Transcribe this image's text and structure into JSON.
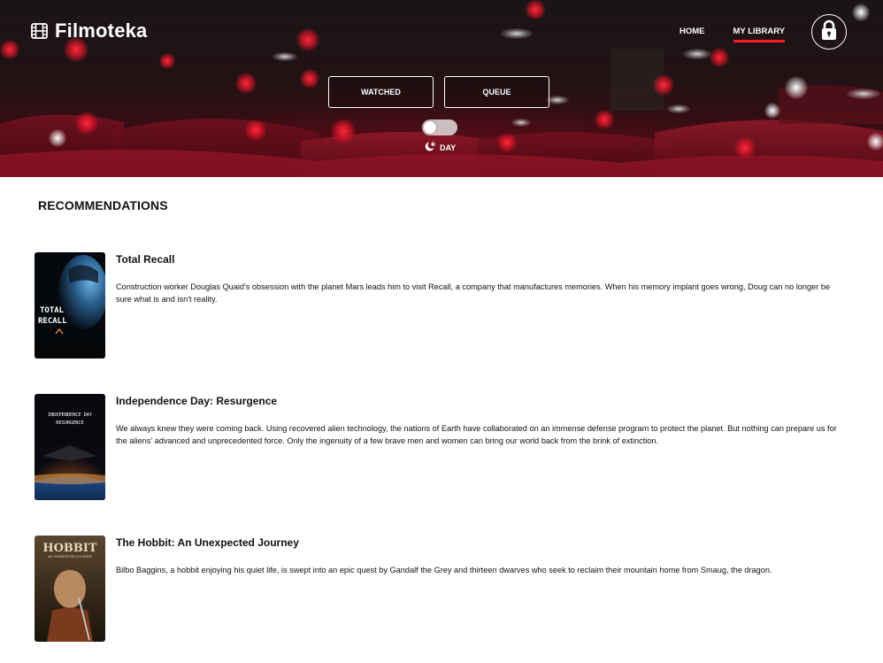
{
  "header": {
    "logo_text": "Filmoteka",
    "nav": {
      "home": "HOME",
      "library": "MY LIBRARY"
    },
    "library_buttons": {
      "watched": "WATCHED",
      "queue": "QUEUE"
    },
    "theme": {
      "label": "DAY",
      "mode": "day"
    }
  },
  "main": {
    "section_title": "RECOMMENDATIONS",
    "movies": [
      {
        "title": "Total Recall",
        "description": "Construction worker Douglas Quaid's obsession with the planet Mars leads him to visit Recall, a company that manufactures memories. When his memory implant goes wrong, Doug can no longer be sure what is and isn't reality.",
        "poster_text": [
          "TOTAL",
          "RECALL"
        ]
      },
      {
        "title": "Independence Day: Resurgence",
        "description": "We always knew they were coming back. Using recovered alien technology, the nations of Earth have collaborated on an immense defense program to protect the planet. But nothing can prepare us for the aliens' advanced and unprecedented force. Only the ingenuity of a few brave men and women can bring our world back from the brink of extinction.",
        "poster_text": [
          "INDEPENDENCE DAY",
          "RESURGENCE"
        ]
      },
      {
        "title": "The Hobbit: An Unexpected Journey",
        "description": "Bilbo Baggins, a hobbit enjoying his quiet life, is swept into an epic quest by Gandalf the Grey and thirteen dwarves who seek to reclaim their mountain home from Smaug, the dragon.",
        "poster_text": [
          "HOBBIT",
          "AN UNEXPECTED JOURNEY"
        ]
      }
    ]
  },
  "colors": {
    "accent": "#ff1a2e",
    "text": "#111111",
    "header_bg": "#2a1216"
  },
  "icons": {
    "logo": "film-icon",
    "lock": "lock-icon",
    "theme": "moon-sun-icon"
  }
}
